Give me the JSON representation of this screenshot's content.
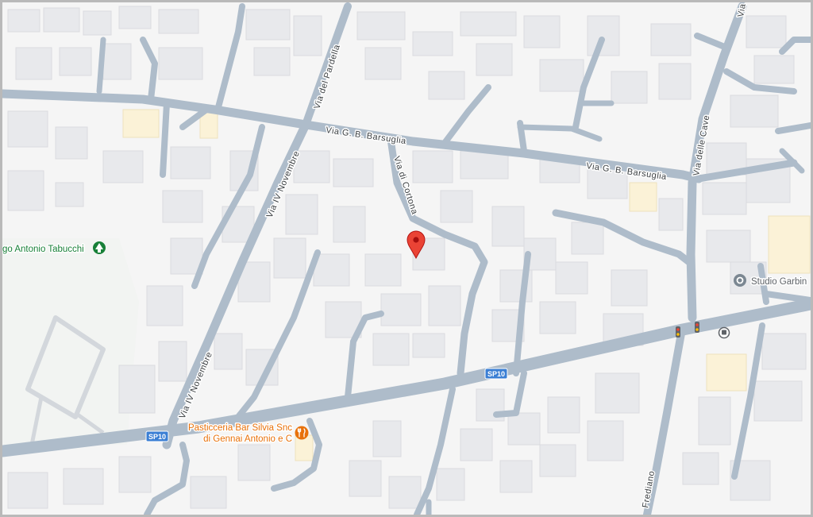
{
  "map": {
    "streets": {
      "via_barsuglia_1": "Via G. B. Barsuglia",
      "via_barsuglia_2": "Via G. B. Barsuglia",
      "via_del_pardella": "Via del Pardella",
      "via_iv_novembre_1": "Via IV Novembre",
      "via_iv_novembre_2": "Via IV Novembre",
      "via_di_cortona": "Via di Cortona",
      "via_delle_cave": "Via delle Cave",
      "frediano": "Frediano",
      "via_top": "Via"
    },
    "shields": {
      "sp10_left": "SP10",
      "sp10_center": "SP10"
    },
    "pois": {
      "park": "go Antonio Tabucchi",
      "studio": "Studio Garbin",
      "pastry_line1": "Pasticceria Bar Silvia Snc",
      "pastry_line2": "di Gennai Antonio e C"
    },
    "colors": {
      "road": "#aebcca",
      "building": "#e8e9ec",
      "background": "#f5f5f5",
      "park_label": "#188038",
      "food_poi": "#e8710a",
      "pin": "#ea4335",
      "shield": "#3b7fd4"
    },
    "icons": {
      "park": "tree-icon",
      "studio": "location-icon",
      "food": "restaurant-icon",
      "pin": "map-pin-icon",
      "traffic": "traffic-light-icon",
      "bus": "bus-stop-icon"
    }
  }
}
